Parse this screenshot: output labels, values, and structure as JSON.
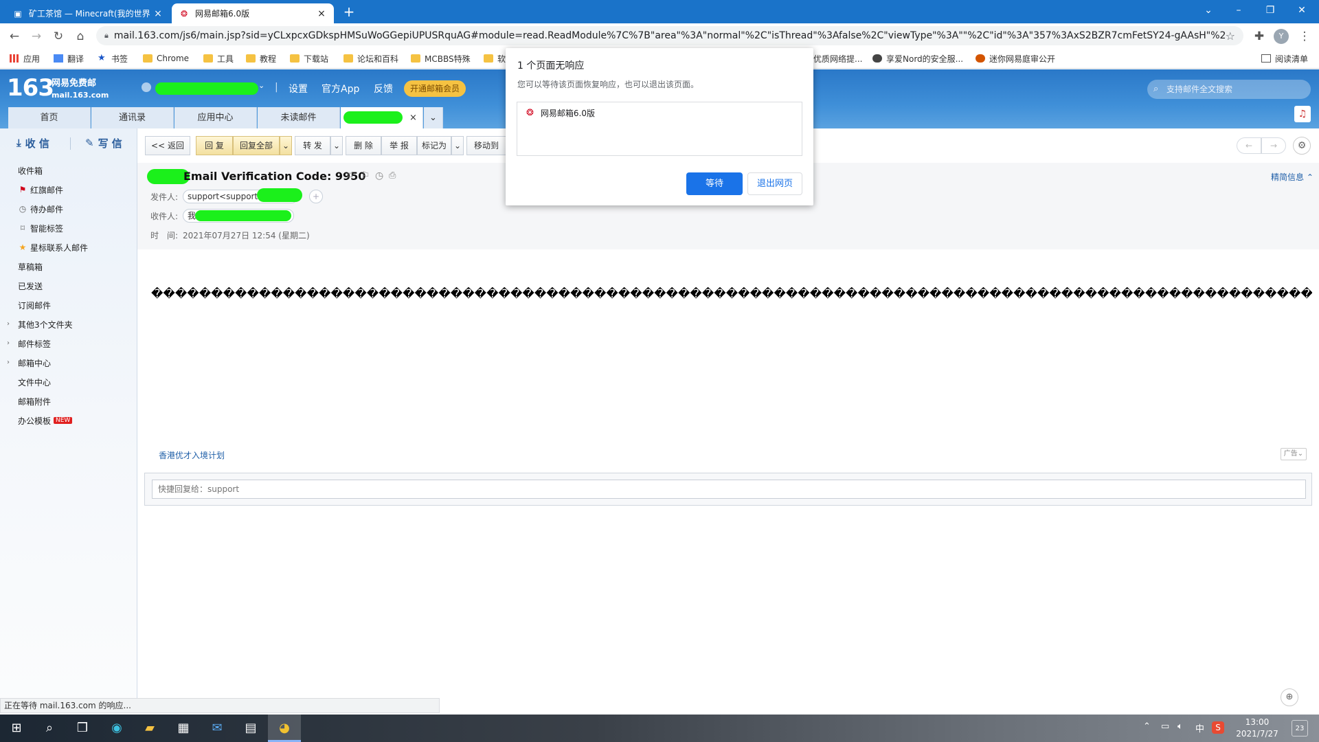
{
  "browser": {
    "tabs": [
      {
        "title": "矿工茶馆 — Minecraft(我的世界",
        "close": "×"
      },
      {
        "title": "网易邮箱6.0版",
        "close": "×"
      }
    ],
    "new_tab": "+",
    "url": "mail.163.com/js6/main.jsp?sid=yCLxpcxGDkspHMSuWoGGepiUPUSRquAG#module=read.ReadModule%7C%7B\"area\"%3A\"normal\"%2C\"isThread\"%3Afalse%2C\"viewType\"%3A\"\"%2C\"id\"%3A\"357%3AxS2BZR7cmFetSY24-gAAsH\"%2C\"fid\"...",
    "bookmarks": [
      "应用",
      "翻译",
      "书签",
      "Chrome",
      "工具",
      "教程",
      "下载站",
      "论坛和百科",
      "MCBBS特殊",
      "软"
    ],
    "bookmarks_right": [
      "优质网络提...",
      "享爱Nord的安全服...",
      "迷你网易庭审公开"
    ],
    "reading_list": "阅读清单",
    "profile_initial": "Y"
  },
  "mail": {
    "logo_number": "163",
    "logo_text": "网易免费邮",
    "logo_sub": "mail.163.com",
    "top_nav": [
      "设置",
      "官方App",
      "反馈"
    ],
    "vip": "开通邮箱会员",
    "search_placeholder": "支持邮件全文搜索",
    "tabs": [
      "首页",
      "通讯录",
      "应用中心",
      "未读邮件"
    ],
    "active_tab_close": "×",
    "receive": "收 信",
    "write": "写 信",
    "folders": [
      {
        "label": "收件箱"
      },
      {
        "label": "红旗邮件"
      },
      {
        "label": "待办邮件"
      },
      {
        "label": "智能标签"
      },
      {
        "label": "星标联系人邮件"
      },
      {
        "label": "草稿箱"
      },
      {
        "label": "已发送"
      },
      {
        "label": "订阅邮件"
      },
      {
        "label": "其他3个文件夹"
      },
      {
        "label": "邮件标签"
      },
      {
        "label": "邮箱中心"
      },
      {
        "label": "文件中心"
      },
      {
        "label": "邮箱附件"
      },
      {
        "label": "办公模板"
      }
    ],
    "new_badge": "NEW",
    "toolbar": {
      "back": "<< 返回",
      "reply": "回 复",
      "reply_all": "回复全部",
      "forward": "转 发",
      "delete": "删 除",
      "report": "举 报",
      "mark_as": "标记为",
      "move_to": "移动到"
    },
    "message": {
      "subject": "Email Verification Code: 9950",
      "from_label": "发件人:",
      "from_value": "support<support@",
      "to_label": "收件人:",
      "to_value": "我",
      "time_label": "时　间:",
      "time_value": "2021年07月27日 12:54 (星期二)",
      "detail_toggle": "精简信息",
      "body": "������������������������������������������������������������������������������������������������������������"
    },
    "ad_link": "香港优才入境计划",
    "ad_tag": "广告",
    "quick_reply_placeholder": "快捷回复给：support"
  },
  "dialog": {
    "title": "1 个页面无响应",
    "message": "您可以等待该页面恢复响应，也可以退出该页面。",
    "item": "网易邮箱6.0版",
    "wait": "等待",
    "exit": "退出网页"
  },
  "status": "正在等待 mail.163.com 的响应...",
  "taskbar": {
    "time": "13:00",
    "date": "2021/7/27",
    "ime": "中",
    "notifications": "23"
  }
}
